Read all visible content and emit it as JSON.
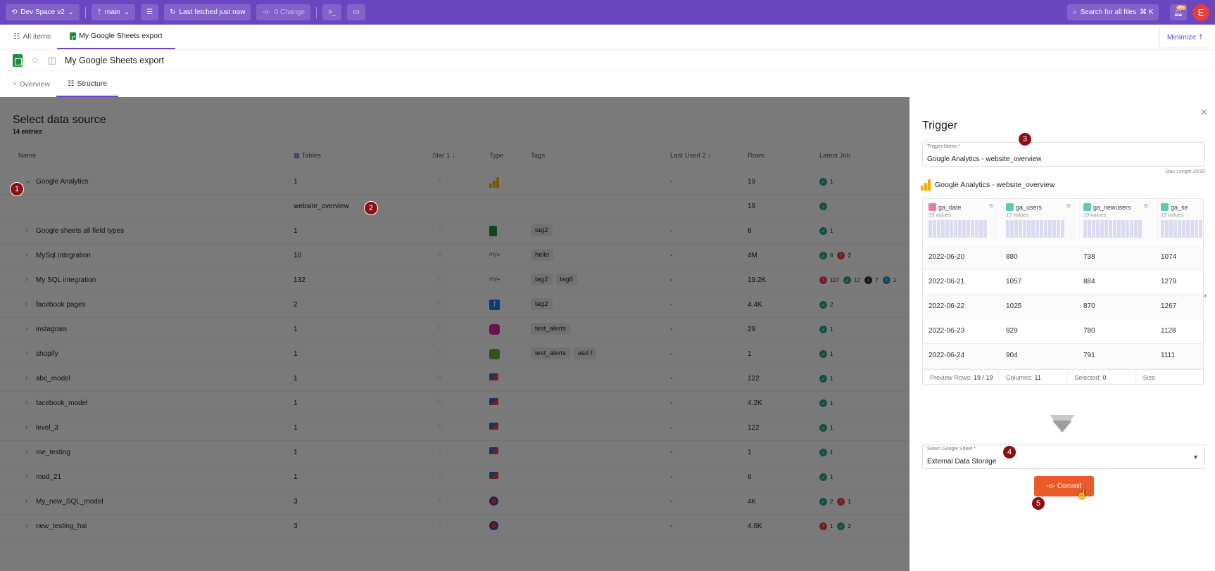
{
  "topbar": {
    "workspace": "Dev Space v2",
    "branch": "main",
    "fetch_status": "Last fetched just now",
    "changes": "0 Change",
    "search_label": "Search for all files",
    "search_shortcut": "⌘ K",
    "notification_badge": "99+",
    "avatar_initial": "E"
  },
  "tabs": {
    "all_items": "All items",
    "current": "My Google Sheets export",
    "minimize": "Minimize"
  },
  "page": {
    "title": "My Google Sheets export",
    "subtabs": [
      "Overview",
      "Structure"
    ]
  },
  "list": {
    "heading": "Select data source",
    "entries": "14 entries",
    "columns": {
      "name": "Name",
      "tables": "Tables",
      "star": "Star",
      "star_sort": "1",
      "type": "Type",
      "tags": "Tags",
      "last_used": "Last Used",
      "last_used_sort": "2",
      "rows": "Rows",
      "latest_job": "Latest Job"
    },
    "rows": [
      {
        "name": "Google Analytics",
        "tables": "1",
        "last": "-",
        "rows": "19",
        "tags": [],
        "type": "ga",
        "jobs": [
          {
            "k": "ok",
            "n": "1"
          }
        ],
        "expanded": true
      },
      {
        "name": "",
        "table": "website_overview",
        "rows": "19",
        "jobs": [
          {
            "k": "ok",
            "n": ""
          }
        ],
        "sub": true
      },
      {
        "name": "Google sheets all field types",
        "tables": "1",
        "last": "-",
        "rows": "6",
        "tags": [
          "tag2"
        ],
        "type": "gsheet",
        "jobs": [
          {
            "k": "ok",
            "n": "1"
          }
        ]
      },
      {
        "name": "MySql Integration",
        "tables": "10",
        "last": "-",
        "rows": "4M",
        "tags": [
          "hello"
        ],
        "type": "mysql",
        "jobs": [
          {
            "k": "ok",
            "n": "8"
          },
          {
            "k": "err",
            "n": "2"
          }
        ]
      },
      {
        "name": "My SQL integration",
        "tables": "132",
        "last": "-",
        "rows": "19.2K",
        "tags": [
          "tag2",
          "tag6"
        ],
        "type": "mysql",
        "jobs": [
          {
            "k": "err",
            "n": "107"
          },
          {
            "k": "ok",
            "n": "17"
          },
          {
            "k": "info",
            "n": "7"
          },
          {
            "k": "inf2",
            "n": "1"
          }
        ]
      },
      {
        "name": "facebook pages",
        "tables": "2",
        "last": "-",
        "rows": "4.4K",
        "tags": [
          "tag2"
        ],
        "type": "facebook",
        "jobs": [
          {
            "k": "ok",
            "n": "2"
          }
        ]
      },
      {
        "name": "instagram",
        "tables": "1",
        "last": "-",
        "rows": "29",
        "tags": [
          "test_alerts"
        ],
        "type": "instagram",
        "jobs": [
          {
            "k": "ok",
            "n": "1"
          }
        ]
      },
      {
        "name": "shopify",
        "tables": "1",
        "last": "-",
        "rows": "1",
        "tags": [
          "test_alerts",
          "asd f"
        ],
        "type": "shopify",
        "jobs": [
          {
            "k": "ok",
            "n": "1"
          }
        ]
      },
      {
        "name": "abc_model",
        "tables": "1",
        "last": "-",
        "rows": "122",
        "tags": [],
        "type": "model",
        "jobs": [
          {
            "k": "ok",
            "n": "1"
          }
        ]
      },
      {
        "name": "facebook_model",
        "tables": "1",
        "last": "-",
        "rows": "4.2K",
        "tags": [],
        "type": "model",
        "jobs": [
          {
            "k": "ok",
            "n": "1"
          }
        ]
      },
      {
        "name": "level_3",
        "tables": "1",
        "last": "-",
        "rows": "122",
        "tags": [],
        "type": "model",
        "jobs": [
          {
            "k": "ok",
            "n": "1"
          }
        ]
      },
      {
        "name": "me_testing",
        "tables": "1",
        "last": "-",
        "rows": "1",
        "tags": [],
        "type": "model",
        "jobs": [
          {
            "k": "ok",
            "n": "1"
          }
        ]
      },
      {
        "name": "mod_21",
        "tables": "1",
        "last": "-",
        "rows": "6",
        "tags": [],
        "type": "model",
        "jobs": [
          {
            "k": "ok",
            "n": "1"
          }
        ]
      },
      {
        "name": "My_new_SQL_model",
        "tables": "3",
        "last": "-",
        "rows": "4K",
        "tags": [],
        "type": "sqlmodel",
        "jobs": [
          {
            "k": "ok",
            "n": "2"
          },
          {
            "k": "err",
            "n": "1"
          }
        ]
      },
      {
        "name": "new_testing_hai",
        "tables": "3",
        "last": "-",
        "rows": "4.6K",
        "tags": [],
        "type": "sqlmodel",
        "jobs": [
          {
            "k": "err",
            "n": "1"
          },
          {
            "k": "ok",
            "n": "2"
          }
        ]
      }
    ]
  },
  "panel": {
    "title": "Trigger",
    "trigger_name_label": "Trigger Name *",
    "trigger_name_value": "Google Analytics - website_overview",
    "max_length": "Max Length 35/90",
    "source_title": "Google Analytics - website_overview",
    "preview": {
      "columns": [
        {
          "name": "ga_date",
          "values": "19 values",
          "color": "#e87ea1"
        },
        {
          "name": "ga_users",
          "values": "19 values",
          "color": "#5ccbb0"
        },
        {
          "name": "ga_newusers",
          "values": "19 values",
          "color": "#5ccbb0"
        },
        {
          "name": "ga_se",
          "values": "19 values",
          "color": "#5ccbb0"
        }
      ],
      "rows": [
        [
          "2022-06-20",
          "880",
          "738",
          "1074"
        ],
        [
          "2022-06-21",
          "1057",
          "884",
          "1279"
        ],
        [
          "2022-06-22",
          "1025",
          "870",
          "1267"
        ],
        [
          "2022-06-23",
          "929",
          "780",
          "1128"
        ],
        [
          "2022-06-24",
          "904",
          "791",
          "1111"
        ]
      ],
      "footer": {
        "preview_rows_label": "Preview Rows:",
        "preview_rows": "19 / 19",
        "columns_label": "Columns:",
        "columns": "11",
        "selected_label": "Selected:",
        "selected": "0",
        "size_label": "Size"
      }
    },
    "sheet_label": "Select Google Sheet *",
    "sheet_value": "External Data Storage",
    "commit": "Commit",
    "commit_icon": "-o-"
  },
  "markers": [
    "1",
    "2",
    "3",
    "4",
    "5"
  ]
}
